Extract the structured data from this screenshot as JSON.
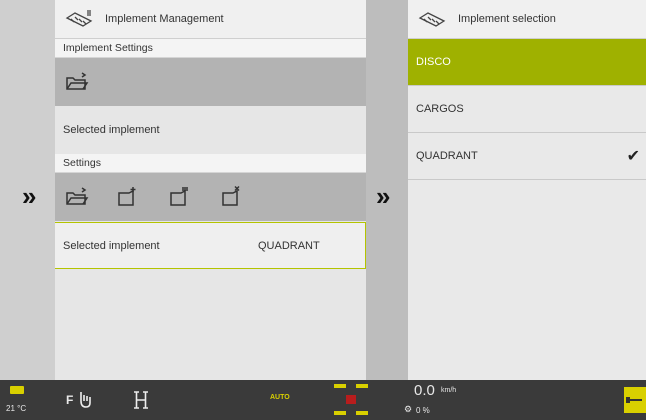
{
  "left_panel": {
    "title": "Implement Management",
    "implement_settings_label": "Implement Settings",
    "selected_implement_label": "Selected implement",
    "settings_label": "Settings",
    "selected_implement_row_label": "Selected implement",
    "selected_implement_value": "QUADRANT"
  },
  "right_panel": {
    "title": "Implement selection",
    "items": [
      {
        "label": "DISCO",
        "active": true,
        "checked": false
      },
      {
        "label": "CARGOS",
        "active": false,
        "checked": false
      },
      {
        "label": "QUADRANT",
        "active": false,
        "checked": true
      }
    ]
  },
  "chevron_glyph": "»",
  "status_bar": {
    "temperature": "21 °C",
    "gear": "F",
    "auto_label": "AUTO",
    "speed_value": "0.0",
    "speed_unit": "km/h",
    "slip_value": "0 %"
  },
  "colors": {
    "accent": "#9fb100",
    "status_bar_bg": "#3a3a3a",
    "status_yellow": "#d9d000"
  }
}
